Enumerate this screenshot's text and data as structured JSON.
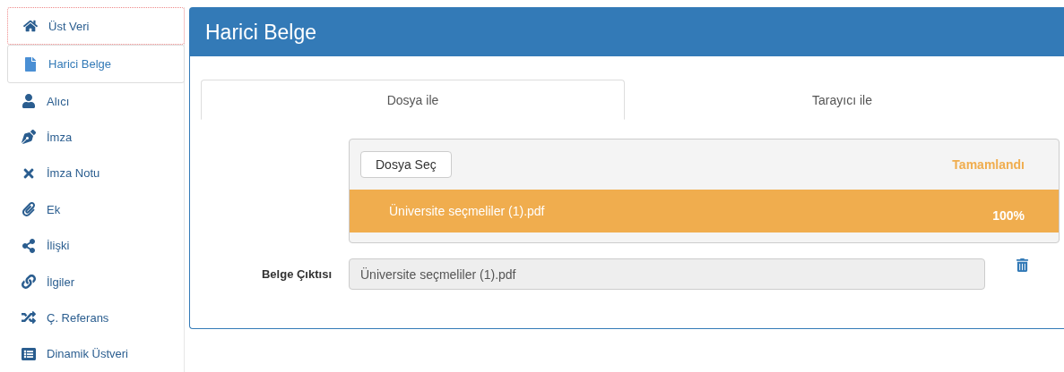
{
  "sidebar": {
    "items": [
      {
        "label": "Üst Veri",
        "selected": false,
        "focused": true
      },
      {
        "label": "Harici Belge",
        "selected": true,
        "focused": false
      },
      {
        "label": "Alıcı",
        "selected": false,
        "focused": false
      },
      {
        "label": "İmza",
        "selected": false,
        "focused": false
      },
      {
        "label": "İmza Notu",
        "selected": false,
        "focused": false
      },
      {
        "label": "Ek",
        "selected": false,
        "focused": false
      },
      {
        "label": "İlişki",
        "selected": false,
        "focused": false
      },
      {
        "label": "İlgiler",
        "selected": false,
        "focused": false
      },
      {
        "label": "Ç. Referans",
        "selected": false,
        "focused": false
      },
      {
        "label": "Dinamik Üstveri",
        "selected": false,
        "focused": false
      }
    ]
  },
  "panel": {
    "title": "Harici Belge",
    "tabs": [
      {
        "label": "Dosya ile",
        "selected": true
      },
      {
        "label": "Tarayıcı ile",
        "selected": false
      }
    ],
    "upload": {
      "button": "Dosya Seç",
      "status": "Tamamlandı",
      "file": {
        "name": "Üniversite seçmeliler (1).pdf",
        "percent": "100%",
        "level": 1
      }
    },
    "output": {
      "label": "Belge Çıktısı",
      "value": "Üniversite seçmeliler (1).pdf"
    }
  }
}
